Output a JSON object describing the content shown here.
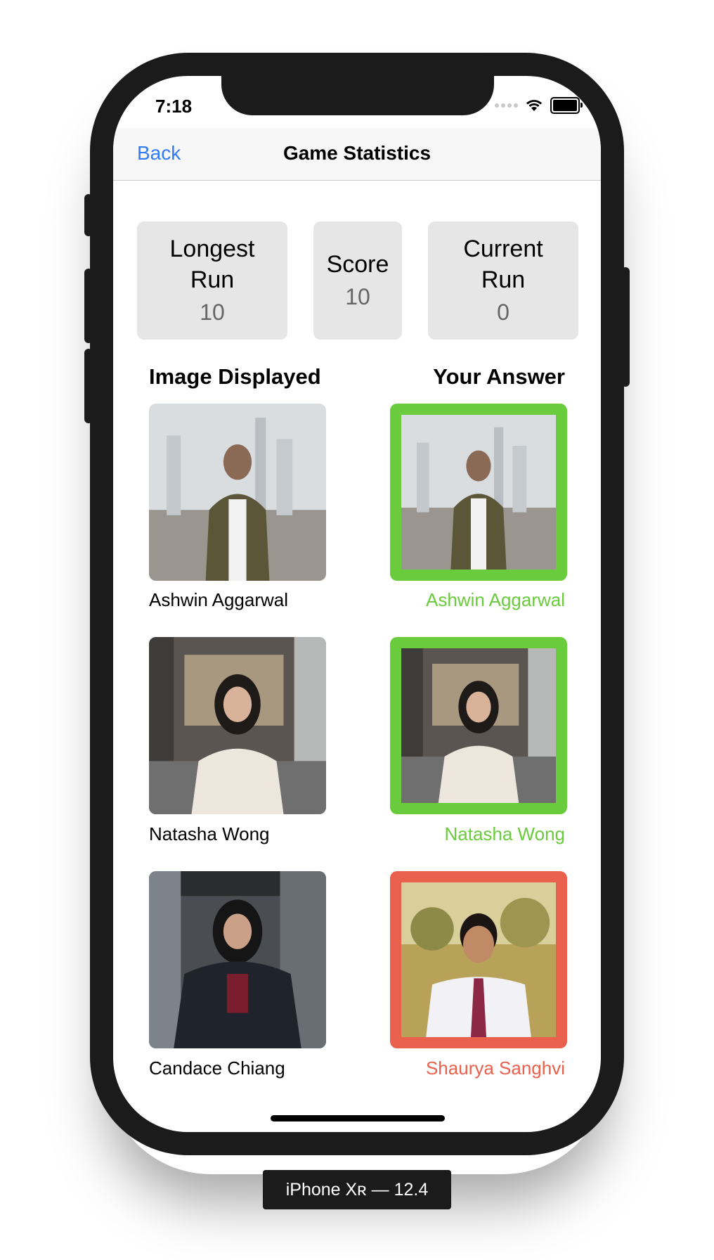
{
  "status_bar": {
    "time": "7:18"
  },
  "nav": {
    "back_label": "Back",
    "title": "Game Statistics"
  },
  "stats": [
    {
      "label_line1": "Longest",
      "label_line2": "Run",
      "value": "10"
    },
    {
      "label_line1": "Score",
      "label_line2": "",
      "value": "10"
    },
    {
      "label_line1": "Current",
      "label_line2": "Run",
      "value": "0"
    }
  ],
  "columns": {
    "left": "Image Displayed",
    "right": "Your Answer"
  },
  "rows": [
    {
      "displayed_name": "Ashwin Aggarwal",
      "answer_name": "Ashwin Aggarwal",
      "correct": true
    },
    {
      "displayed_name": "Natasha Wong",
      "answer_name": "Natasha Wong",
      "correct": true
    },
    {
      "displayed_name": "Candace Chiang",
      "answer_name": "Shaurya Sanghvi",
      "correct": false
    }
  ],
  "colors": {
    "correct": "#6acb3c",
    "wrong": "#e9604c",
    "link": "#2f7cf6"
  },
  "device_label": "iPhone Xʀ — 12.4"
}
